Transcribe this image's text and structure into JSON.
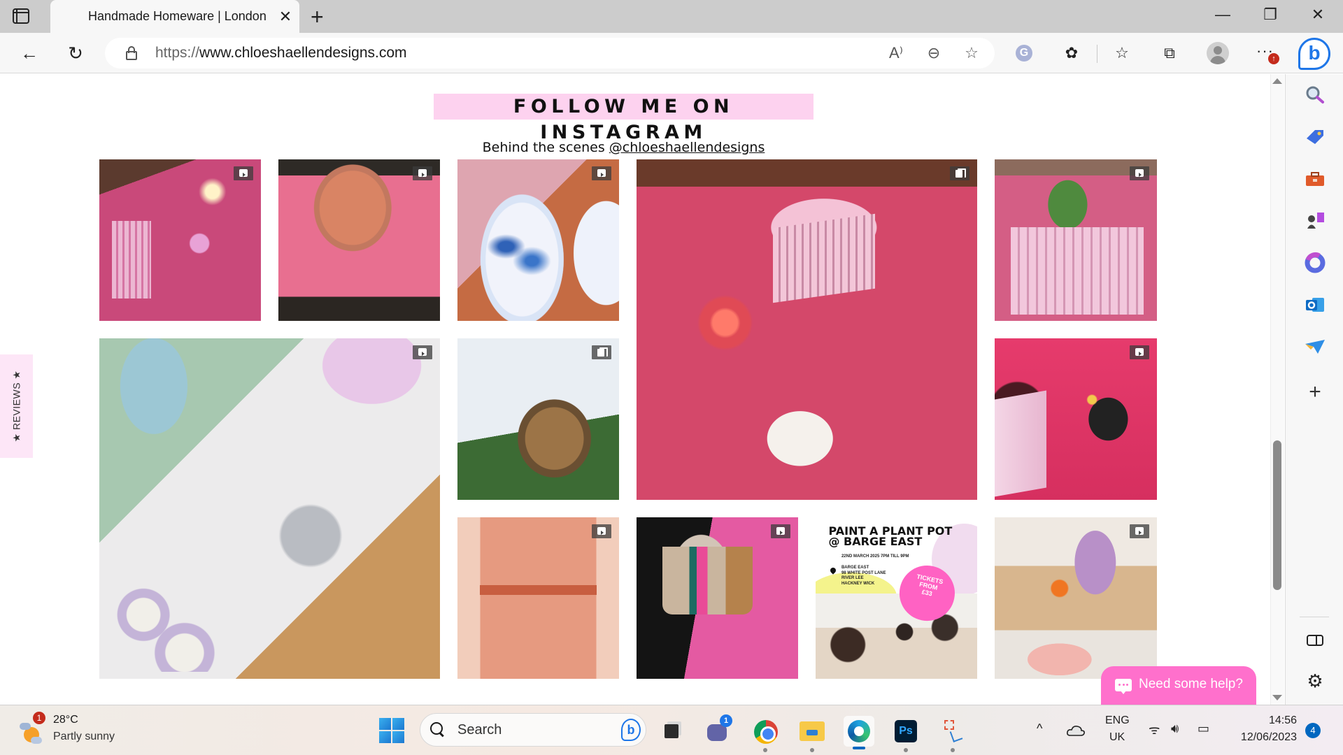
{
  "browser": {
    "tab": {
      "title": "Handmade Homeware | London | Chloe Shaellen Designs",
      "close_glyph": "✕"
    },
    "new_tab_glyph": "+",
    "window_controls": {
      "minimize": "—",
      "restore": "❐",
      "close": "✕"
    },
    "nav": {
      "back": "←",
      "refresh": "↻"
    },
    "address": {
      "scheme": "https://",
      "host": "www.chloeshaellendesigns.com"
    },
    "omnibox_icons": {
      "read_aloud": "A⁾",
      "zoom_out": "⊖",
      "add_favorite": "☆"
    },
    "extension_letter": "G",
    "toolbar_icons": {
      "extensions": "✿",
      "favorites": "☆",
      "collections": "⧉",
      "more": "···"
    },
    "update_badge": "↑",
    "bing_letter": "b"
  },
  "page": {
    "heading": "FOLLOW ME ON INSTAGRAM",
    "subtitle_prefix": "Behind the scenes ",
    "instagram_handle": "@chloeshaellendesigns",
    "tiles": [
      {
        "name": "candle-table-reel",
        "badge": "reel"
      },
      {
        "name": "pot-painting-reel",
        "badge": "reel"
      },
      {
        "name": "marbled-trays-reel",
        "badge": "reel"
      },
      {
        "name": "event-table-carousel",
        "badge": "carousel"
      },
      {
        "name": "crate-supplies-reel",
        "badge": "reel"
      },
      {
        "name": "homeware-flatlay-reel",
        "badge": "reel"
      },
      {
        "name": "kids-painting-carousel",
        "badge": "carousel"
      },
      {
        "name": "hair-accessory-holder-reel",
        "badge": "reel"
      },
      {
        "name": "apron-reel",
        "badge": "reel"
      },
      {
        "name": "painted-pot-reel",
        "badge": "reel"
      },
      {
        "name": "barge-east-event-post",
        "badge": "none"
      },
      {
        "name": "pouring-resin-reel",
        "badge": "reel"
      }
    ],
    "event_poster": {
      "title_line1": "PAINT A PLANT POT",
      "title_line2": "@ BARGE EAST",
      "date": "22ND MARCH 2025    7PM TILL 9PM",
      "address_lines": [
        "BARGE EAST",
        "98 WHITE POST LANE",
        "RIVER LEE",
        "HACKNEY WICK"
      ],
      "ticket_badge": [
        "TICKETS",
        "FROM",
        "£33"
      ]
    },
    "reviews_tab": "★ REVIEWS ★",
    "help_chat": "Need some help?",
    "colors": {
      "heading_bg": "#fdd2ef",
      "chat_bg": "#ff70cc",
      "reviews_bg": "#fde6f7"
    }
  },
  "sidebar": {
    "items": [
      "search",
      "shopping",
      "tools",
      "games",
      "microsoft-365",
      "outlook",
      "send"
    ],
    "add_glyph": "+",
    "split_glyph": "▭",
    "settings_glyph": "⚙"
  },
  "taskbar": {
    "weather": {
      "temp": "28°C",
      "desc": "Partly sunny",
      "badge": "1"
    },
    "search_label": "Search",
    "teams_badge": "1",
    "ps_label": "Ps",
    "tray": {
      "chevron": "^",
      "lang1": "ENG",
      "lang2": "UK",
      "wifi": "ᯤ",
      "volume": "🔊︎",
      "battery": "▭"
    },
    "clock": {
      "time": "14:56",
      "date": "12/06/2023"
    },
    "notifications": "4"
  }
}
